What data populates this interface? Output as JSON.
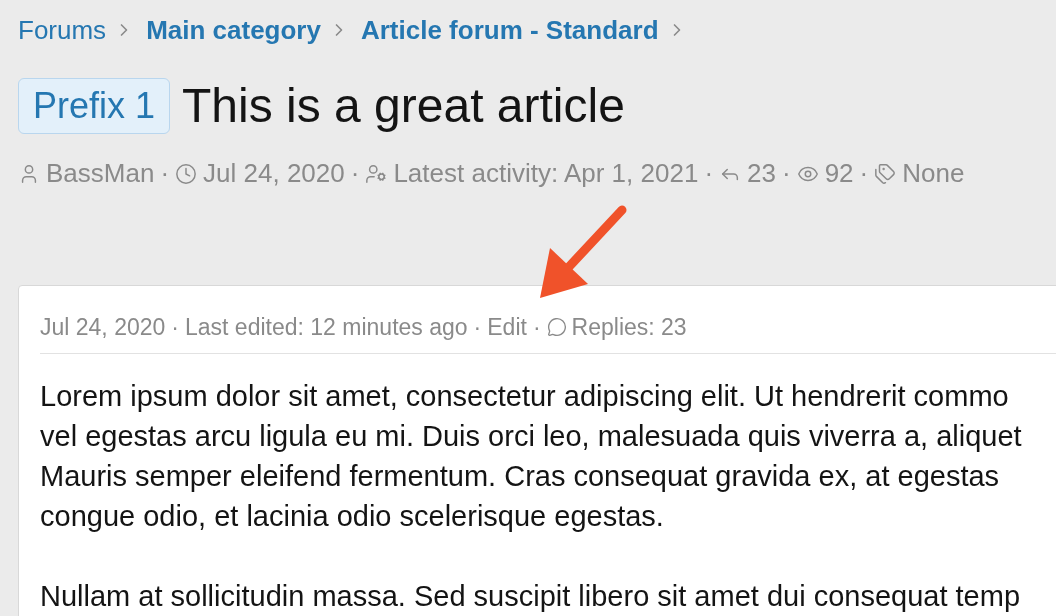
{
  "breadcrumb": [
    {
      "label": "Forums",
      "bold": false
    },
    {
      "label": "Main category",
      "bold": true
    },
    {
      "label": "Article forum - Standard",
      "bold": true
    }
  ],
  "thread": {
    "separator": "·",
    "prefix": "Prefix 1",
    "title": "This is a great article",
    "meta": [
      {
        "kind": "author",
        "text": "BassMan"
      },
      {
        "kind": "date",
        "text": "Jul 24, 2020"
      },
      {
        "kind": "activity",
        "text": "Latest activity: Apr 1, 2021"
      },
      {
        "kind": "replies",
        "text": "23"
      },
      {
        "kind": "views",
        "text": "92"
      },
      {
        "kind": "tags",
        "text": "None"
      }
    ]
  },
  "post": {
    "separator": "·",
    "header": [
      {
        "kind": "text",
        "text": "Jul 24, 2020"
      },
      {
        "kind": "text",
        "text": "Last edited: 12 minutes ago"
      },
      {
        "kind": "link",
        "text": "Edit"
      },
      {
        "kind": "replies",
        "text": "Replies: 23"
      }
    ],
    "paragraphs": [
      [
        "Lorem ipsum dolor sit amet, consectetur adipiscing elit. Ut hendrerit commo",
        "vel egestas arcu ligula eu mi. Duis orci leo, malesuada quis viverra a, aliquet",
        "Mauris semper eleifend fermentum. Cras consequat gravida ex, at egestas",
        "congue odio, et lacinia odio scelerisque egestas."
      ],
      [
        "Nullam at sollicitudin massa. Sed suscipit libero sit amet dui consequat temp"
      ]
    ]
  }
}
